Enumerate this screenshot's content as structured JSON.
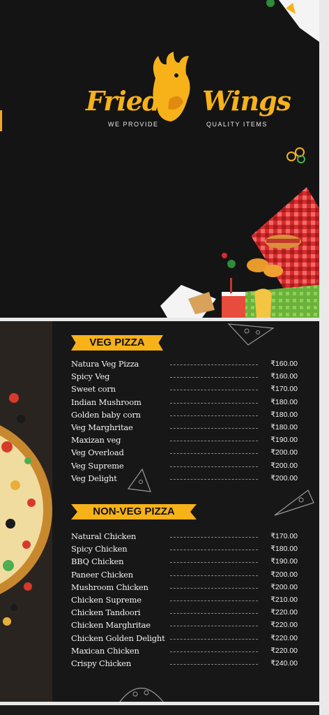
{
  "brand": {
    "word1": "Fried",
    "word2": "Wings",
    "tagline_left": "WE PROVIDE",
    "tagline_right": "QUALITY ITEMS"
  },
  "colors": {
    "accent": "#f7b21a",
    "panel": "#151515",
    "text": "#f2f2f2"
  },
  "menu": {
    "sections": [
      {
        "title": "VEG PIZZA",
        "items": [
          {
            "name": "Natura  Veg Pizza",
            "price": "₹160.00"
          },
          {
            "name": "Spicy Veg",
            "price": "₹160.00"
          },
          {
            "name": "Sweet corn",
            "price": "₹170.00"
          },
          {
            "name": "Indian Mushroom",
            "price": "₹180.00"
          },
          {
            "name": "Golden baby corn",
            "price": "₹180.00"
          },
          {
            "name": "Veg Marghritae",
            "price": "₹180.00"
          },
          {
            "name": "Maxizan veg",
            "price": "₹190.00"
          },
          {
            "name": "Veg Overload",
            "price": "₹200.00"
          },
          {
            "name": "Veg Supreme",
            "price": "₹200.00"
          },
          {
            "name": "Veg Delight",
            "price": "₹200.00"
          }
        ]
      },
      {
        "title": "NON-VEG PIZZA",
        "items": [
          {
            "name": "Natural Chicken",
            "price": "₹170.00"
          },
          {
            "name": "Spicy Chicken",
            "price": "₹180.00"
          },
          {
            "name": "BBQ Chicken",
            "price": "₹190.00"
          },
          {
            "name": "Paneer Chicken",
            "price": "₹200.00"
          },
          {
            "name": "Mushroom Chicken",
            "price": "₹200.00"
          },
          {
            "name": "Chicken Supreme",
            "price": "₹210.00"
          },
          {
            "name": "Chicken Tandoori",
            "price": "₹220.00"
          },
          {
            "name": "Chicken Marghritae",
            "price": "₹220.00"
          },
          {
            "name": "Chicken Golden Delight",
            "price": "₹220.00"
          },
          {
            "name": "Maxican Chicken",
            "price": "₹220.00"
          },
          {
            "name": "Crispy Chicken",
            "price": "₹240.00"
          }
        ]
      }
    ]
  }
}
